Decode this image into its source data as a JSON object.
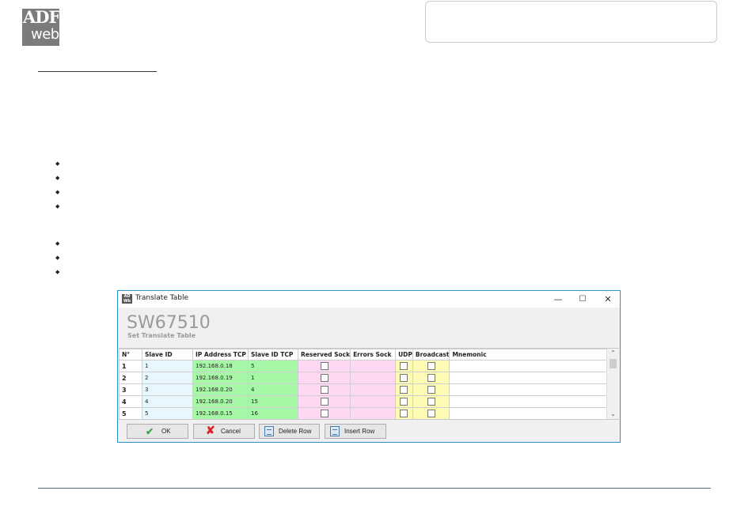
{
  "page": {
    "logo": {
      "line1": "ADF",
      "line2": "web"
    },
    "heading": "",
    "bullets_group1": [
      "",
      "",
      "",
      ""
    ],
    "bullets_group2": [
      "",
      "",
      ""
    ]
  },
  "dialog": {
    "window_title": "Translate Table",
    "window_controls": {
      "minimize": "—",
      "maximize": "☐",
      "close": "✕"
    },
    "device_name": "SW67510",
    "subtitle": "Set Translate Table",
    "table": {
      "headers": [
        "N°",
        "Slave ID",
        "IP Address TCP",
        "Slave ID TCP",
        "Reserved Sock",
        "Errors Sock",
        "UDP",
        "Broadcast",
        "Mnemonic"
      ],
      "rows": [
        {
          "num": "1",
          "slave_id": "1",
          "ip": "192.168.0.18",
          "slave_id_tcp": "5",
          "reserved_sock": false,
          "errors_sock": "",
          "udp": false,
          "broadcast": false,
          "mnemonic": ""
        },
        {
          "num": "2",
          "slave_id": "2",
          "ip": "192.168.0.19",
          "slave_id_tcp": "1",
          "reserved_sock": false,
          "errors_sock": "",
          "udp": false,
          "broadcast": false,
          "mnemonic": ""
        },
        {
          "num": "3",
          "slave_id": "3",
          "ip": "192.168.0.20",
          "slave_id_tcp": "4",
          "reserved_sock": false,
          "errors_sock": "",
          "udp": false,
          "broadcast": false,
          "mnemonic": ""
        },
        {
          "num": "4",
          "slave_id": "4",
          "ip": "192.168.0.20",
          "slave_id_tcp": "15",
          "reserved_sock": false,
          "errors_sock": "",
          "udp": false,
          "broadcast": false,
          "mnemonic": ""
        },
        {
          "num": "5",
          "slave_id": "5",
          "ip": "192.168.0.15",
          "slave_id_tcp": "16",
          "reserved_sock": false,
          "errors_sock": "",
          "udp": false,
          "broadcast": false,
          "mnemonic": ""
        }
      ]
    },
    "buttons": {
      "ok": "OK",
      "cancel": "Cancel",
      "delete_row": "Delete Row",
      "insert_row": "Insert Row"
    }
  },
  "icons": {
    "app": "adfweb-app-icon",
    "ok": "check-icon",
    "cancel": "x-icon",
    "delete_row": "delete-row-icon",
    "insert_row": "insert-row-icon",
    "bullet": "bullet-icon",
    "scroll_up": "chevron-up-icon",
    "scroll_down": "chevron-down-icon"
  },
  "colors": {
    "slave_id": "#e7f7fd",
    "ip_and_slave_tcp": "#a6f7a6",
    "sock_columns": "#fcd8f2",
    "udp_broadcast": "#fefbb5",
    "window_border": "#2a93c6",
    "footer_line": "#4a6f86"
  }
}
